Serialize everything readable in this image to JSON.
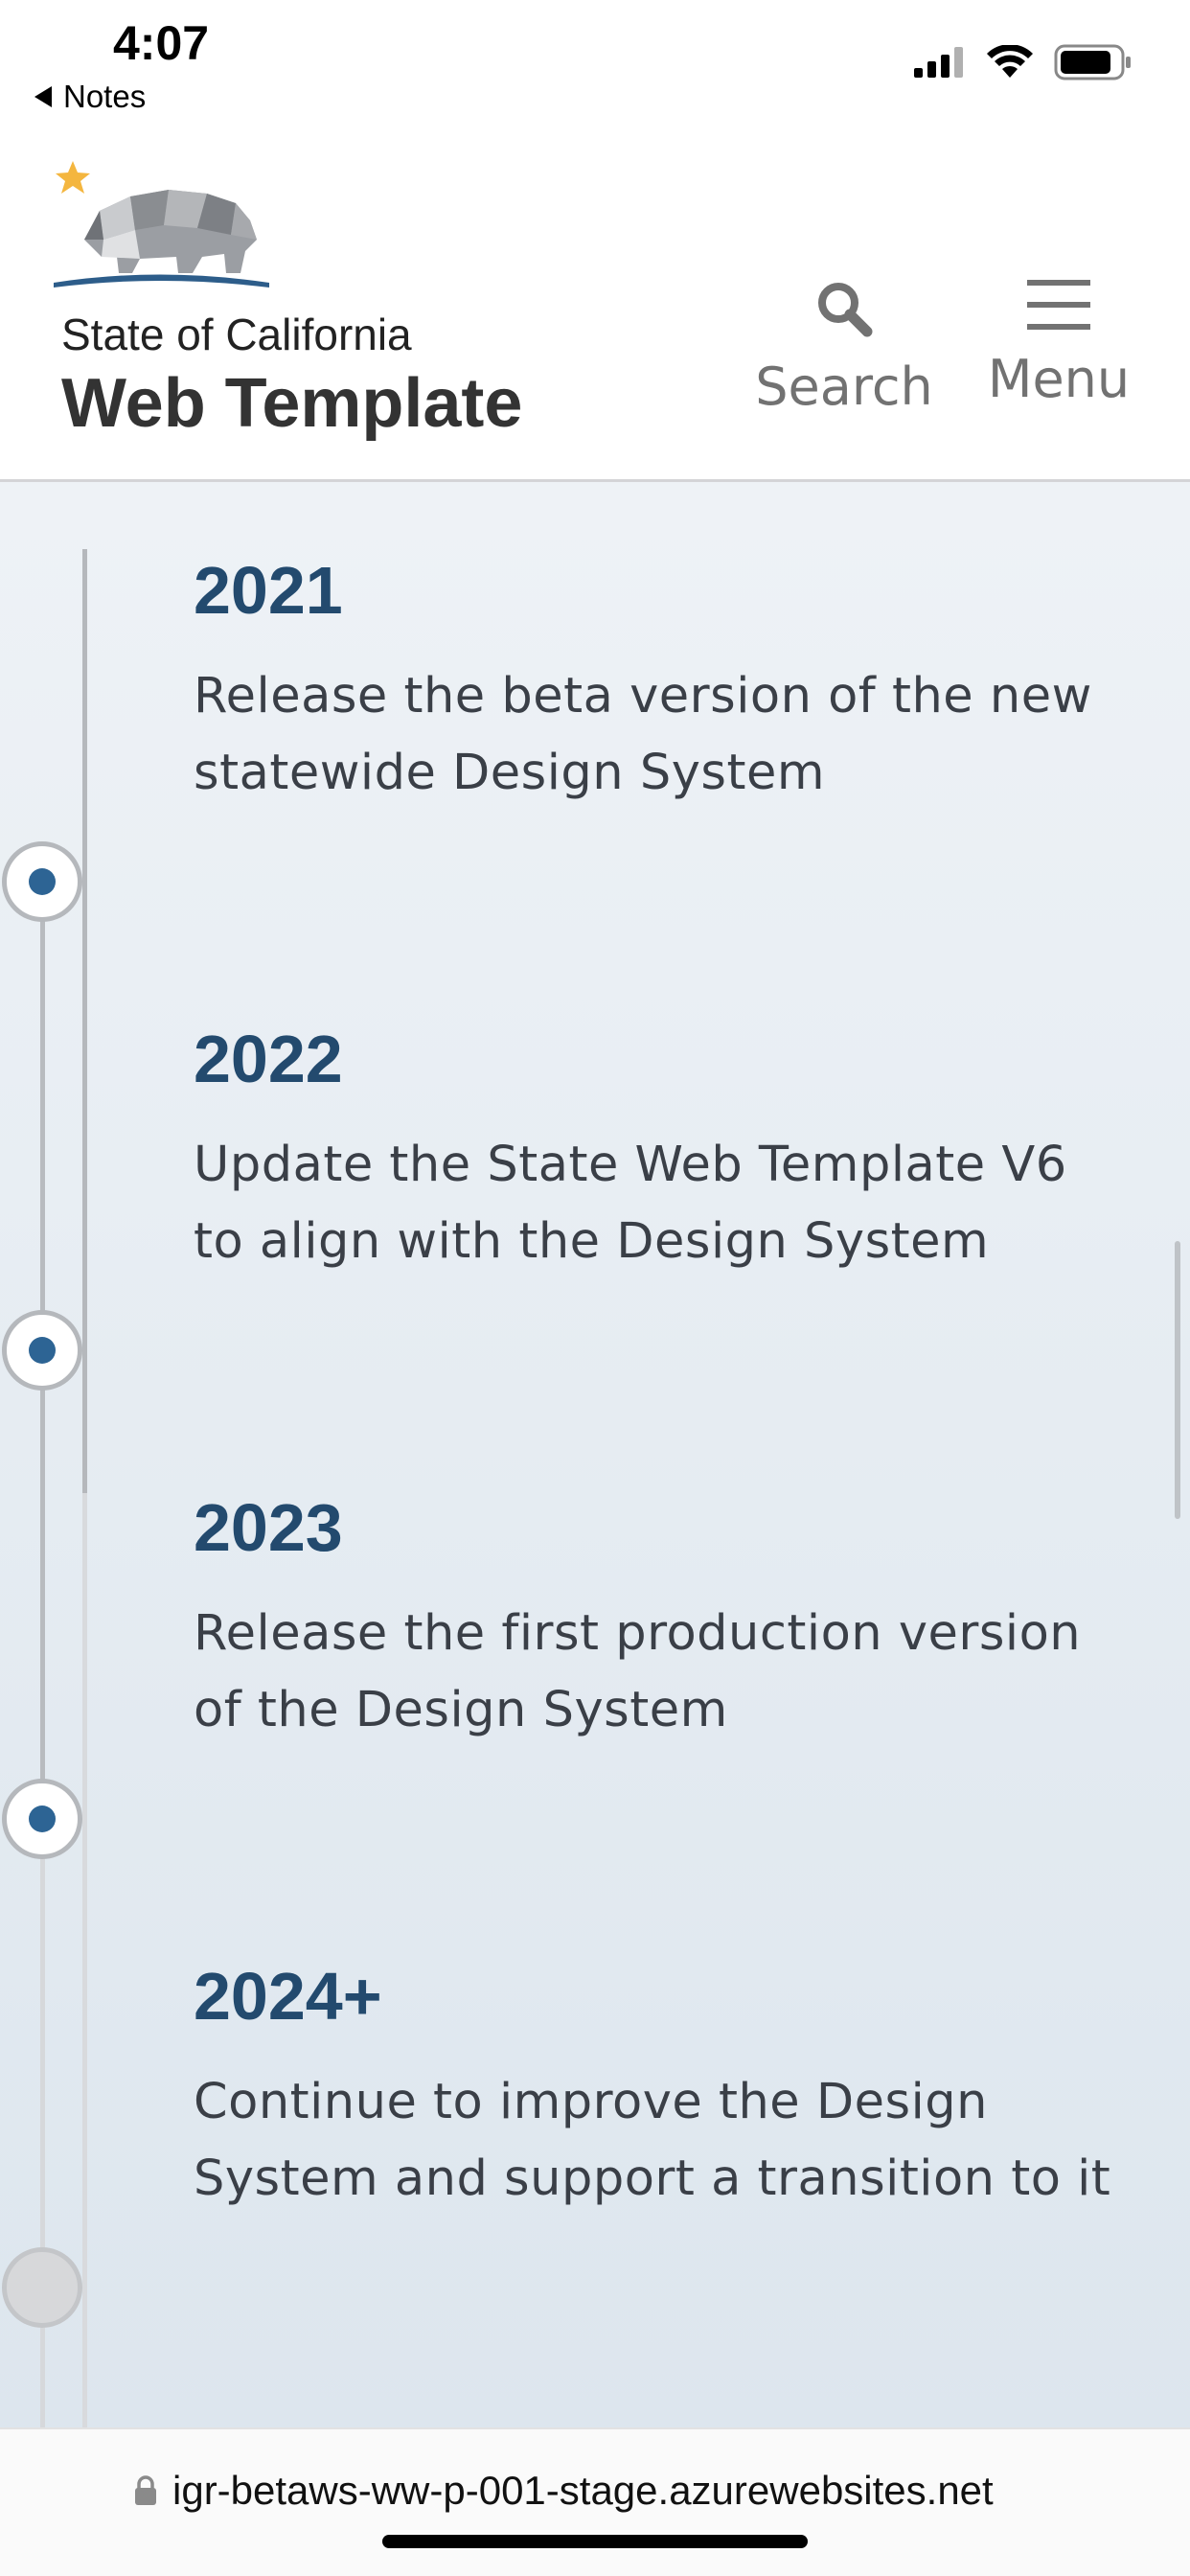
{
  "status_bar": {
    "time": "4:07",
    "back_label": "Notes",
    "icons": [
      "cellular-signal-icon",
      "wifi-icon",
      "battery-icon"
    ]
  },
  "header": {
    "org_name": "State of California",
    "site_title": "Web Template",
    "search_label": "Search",
    "menu_label": "Menu",
    "icons": [
      "bear-logo-icon",
      "search-icon",
      "hamburger-menu-icon"
    ]
  },
  "timeline": {
    "items": [
      {
        "year": "2021",
        "description": "Release the beta version of the new statewide Design System"
      },
      {
        "year": "2022",
        "description": "Update the State Web Template V6 to align with the Design System"
      },
      {
        "year": "2023",
        "description": "Release the first production version of the Design System"
      },
      {
        "year": "2024+",
        "description": "Continue to improve the Design System and support a transition to it"
      }
    ]
  },
  "browser": {
    "url": "igr-betaws-ww-p-001-stage.azurewebsites.net"
  },
  "colors": {
    "accent": "#2d6494",
    "year_text": "#234a6e",
    "body_text": "#3a3f47",
    "logo_star": "#f4b63f",
    "logo_ground": "#2d5d8a"
  }
}
